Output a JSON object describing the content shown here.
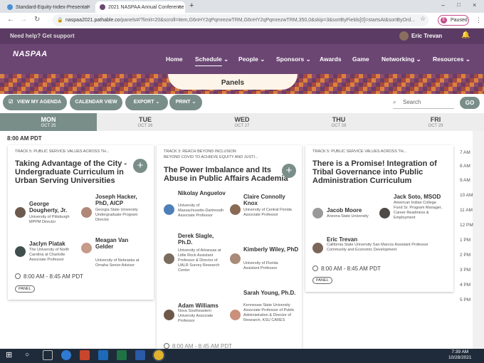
{
  "browser": {
    "tabs": [
      {
        "title": "Standard-Equity-Index-Presentat"
      },
      {
        "title": "2021 NASPAA Annual Conference"
      }
    ],
    "url_host": "naspaa2021.pathable.co",
    "url_rest": "/panels#/?limit=20&scroll=item,G6nHY2qPqmrezwTRM,G6nHY2qPqmrezwTRM,350,0&skip=3&sortByFields[0]=startsAt&sortByOrd...",
    "profile_label": "Paused"
  },
  "site": {
    "help_text": "Need help? Get support",
    "user_name": "Eric Trevan",
    "logo_text": "NASPAA",
    "nav": [
      "Home",
      "Schedule",
      "People",
      "Sponsors",
      "Awards",
      "Game",
      "Networking",
      "Resources"
    ],
    "banner_title": "Panels"
  },
  "toolbar": {
    "my_agenda": "VIEW MY AGENDA",
    "calendar": "CALENDAR VIEW",
    "export": "EXPORT",
    "print": "PRINT",
    "search_placeholder": "Search",
    "go": "GO"
  },
  "days": [
    {
      "day": "MON",
      "date": "OCT 25"
    },
    {
      "day": "TUE",
      "date": "OCT 26"
    },
    {
      "day": "WED",
      "date": "OCT 27"
    },
    {
      "day": "THU",
      "date": "OCT 28"
    },
    {
      "day": "FRI",
      "date": "OCT 29"
    }
  ],
  "time_header": "8:00 AM PDT",
  "hours": [
    "7 AM",
    "8 AM",
    "9 AM",
    "10 AM",
    "11 AM",
    "12 PM",
    "1 PM",
    "2 PM",
    "3 PM",
    "4 PM",
    "5 PM"
  ],
  "cards": [
    {
      "track": "TRACK 5: PUBLIC SERVICE VALUES ACROSS TH...",
      "title_lines": [
        "Taking Advantage of the City -",
        "Undergraduate Curriculum in",
        "Urban Serving Universities"
      ],
      "people": [
        {
          "name": "George Dougherty, Jr.",
          "desc": "University of Pittsburgh MPPM Director"
        },
        {
          "name": "Joseph Hacker, PhD, AICP",
          "desc": "Georgia State University Undergraduate Program Director"
        },
        {
          "name": "Jaclyn Piatak",
          "desc": "The University of North Carolina at Charlotte Associate Professor"
        },
        {
          "name": "Meagan Van Gelder",
          "desc": "University of Nebraska at Omaha Senior Advisor"
        }
      ],
      "time": "8:00 AM - 8:45 AM PDT",
      "tag": "PANEL"
    },
    {
      "track": "TRACK 3: REACH BEYOND INCLUSION",
      "subtrack": "BEYOND COVID TO ACHIEVE EQUITY AND JUSTI...",
      "title_lines": [
        "The Power Imbalance and Its",
        "Abuse in Public Affairs Academia"
      ],
      "people": [
        {
          "name": "Nikolay Anguelov",
          "desc": "University of Massachusetts-Dartmouth Associate Professor"
        },
        {
          "name": "Claire Connolly Knox",
          "desc": "University of Central Florida Associate Professor"
        },
        {
          "name": "Derek Slagle, Ph.D.",
          "desc": "University of Arkansas at Little Rock Assistant Professor & Director of UALR Survey Research Center"
        },
        {
          "name": "Kimberly Wiley, PhD",
          "desc": "University of Florida Assistant Professor"
        },
        {
          "name": "Adam Williams",
          "desc": "Nova Southeastern University Associate Professor"
        },
        {
          "name": "Sarah Young, Ph.D.",
          "desc": "Kennesaw State University Associate Professor of Public Administration & Director of Research, KSU CARES"
        }
      ],
      "time": "8:00 AM - 8:45 AM PDT"
    },
    {
      "track": "TRACK 5: PUBLIC SERVICE VALUES ACROSS TH...",
      "title_lines": [
        "There is a Promise! Integration of",
        "Tribal Governance into Public",
        "Administration Curriculum"
      ],
      "people": [
        {
          "name": "Jacob Moore",
          "desc": "Arizona State University"
        },
        {
          "name": "Jack Soto, MSOD",
          "desc": "American Indian College Fund Sr. Program Manager, Career Readiness & Employment"
        },
        {
          "name": "Eric Trevan",
          "desc": "California State University San Marcos Assistant Professor Community and Economic Development"
        }
      ],
      "time": "8:00 AM - 8:45 AM PDT",
      "tag": "PANEL"
    }
  ],
  "taskbar": {
    "time": "7:39 AM",
    "date": "10/28/2021"
  }
}
